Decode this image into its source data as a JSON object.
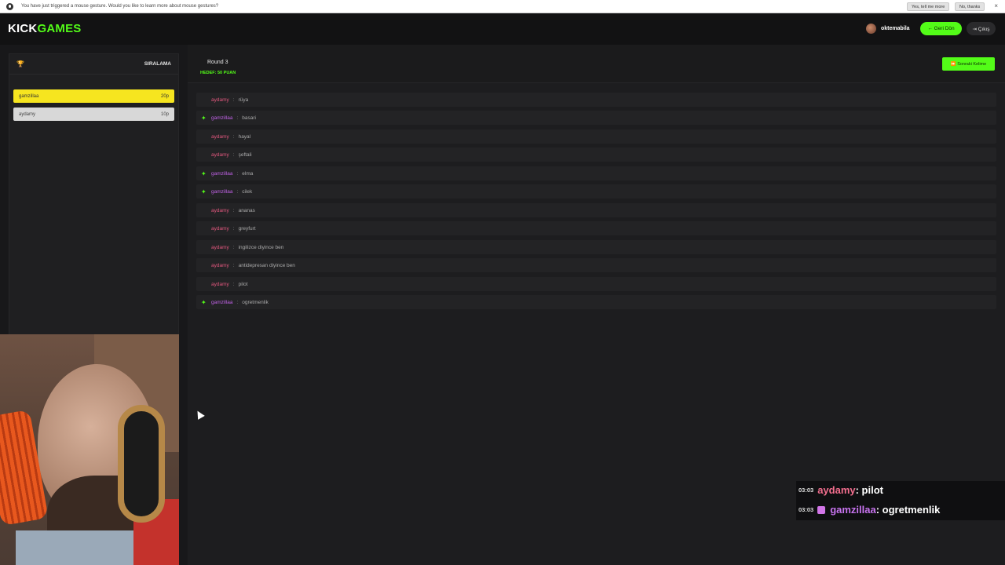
{
  "notification": {
    "text": "You have just triggered a mouse gesture. Would you like to learn more about mouse gestures?",
    "yes_label": "Yes, tell me more",
    "no_label": "No, thanks",
    "close": "×"
  },
  "header": {
    "logo_kick": "KICK",
    "logo_games": "GAMES",
    "username": "oktemabila",
    "back_label": "← Geri Dön",
    "exit_label": "⇥ Çıkış"
  },
  "ranking": {
    "title": "SIRALAMA",
    "rows": [
      {
        "name": "gamzillaa",
        "score": "20p"
      },
      {
        "name": "aydamy",
        "score": "10p"
      }
    ]
  },
  "round": {
    "title": "Round 3",
    "target": "HEDEF: 50 PUAN",
    "next_label": "⏩ Sonraki Kelime"
  },
  "guesses": [
    {
      "name": "aydamy",
      "word": "rüya",
      "correct": false
    },
    {
      "name": "gamzillaa",
      "word": "basari",
      "correct": true
    },
    {
      "name": "aydamy",
      "word": "hayal",
      "correct": false
    },
    {
      "name": "aydamy",
      "word": "şeftali",
      "correct": false
    },
    {
      "name": "gamzillaa",
      "word": "elma",
      "correct": true
    },
    {
      "name": "gamzillaa",
      "word": "cilek",
      "correct": true
    },
    {
      "name": "aydamy",
      "word": "ananas",
      "correct": false
    },
    {
      "name": "aydamy",
      "word": "greyfurt",
      "correct": false
    },
    {
      "name": "aydamy",
      "word": "ingilizce diyince ben",
      "correct": false
    },
    {
      "name": "aydamy",
      "word": "antidepresan diyince ben",
      "correct": false
    },
    {
      "name": "aydamy",
      "word": "pilot",
      "correct": false
    },
    {
      "name": "gamzillaa",
      "word": "ogretmenlik",
      "correct": true
    }
  ],
  "chat_overlay": [
    {
      "time": "03:03",
      "name": "aydamy",
      "message": ": pilot"
    },
    {
      "time": "03:03",
      "name": "gamzillaa",
      "message": ": ogretmenlik"
    }
  ],
  "colors": {
    "accent": "#53fc18",
    "first_place": "#f6e51f",
    "aydamy": "#e4587f",
    "gamzillaa": "#c061e6"
  }
}
